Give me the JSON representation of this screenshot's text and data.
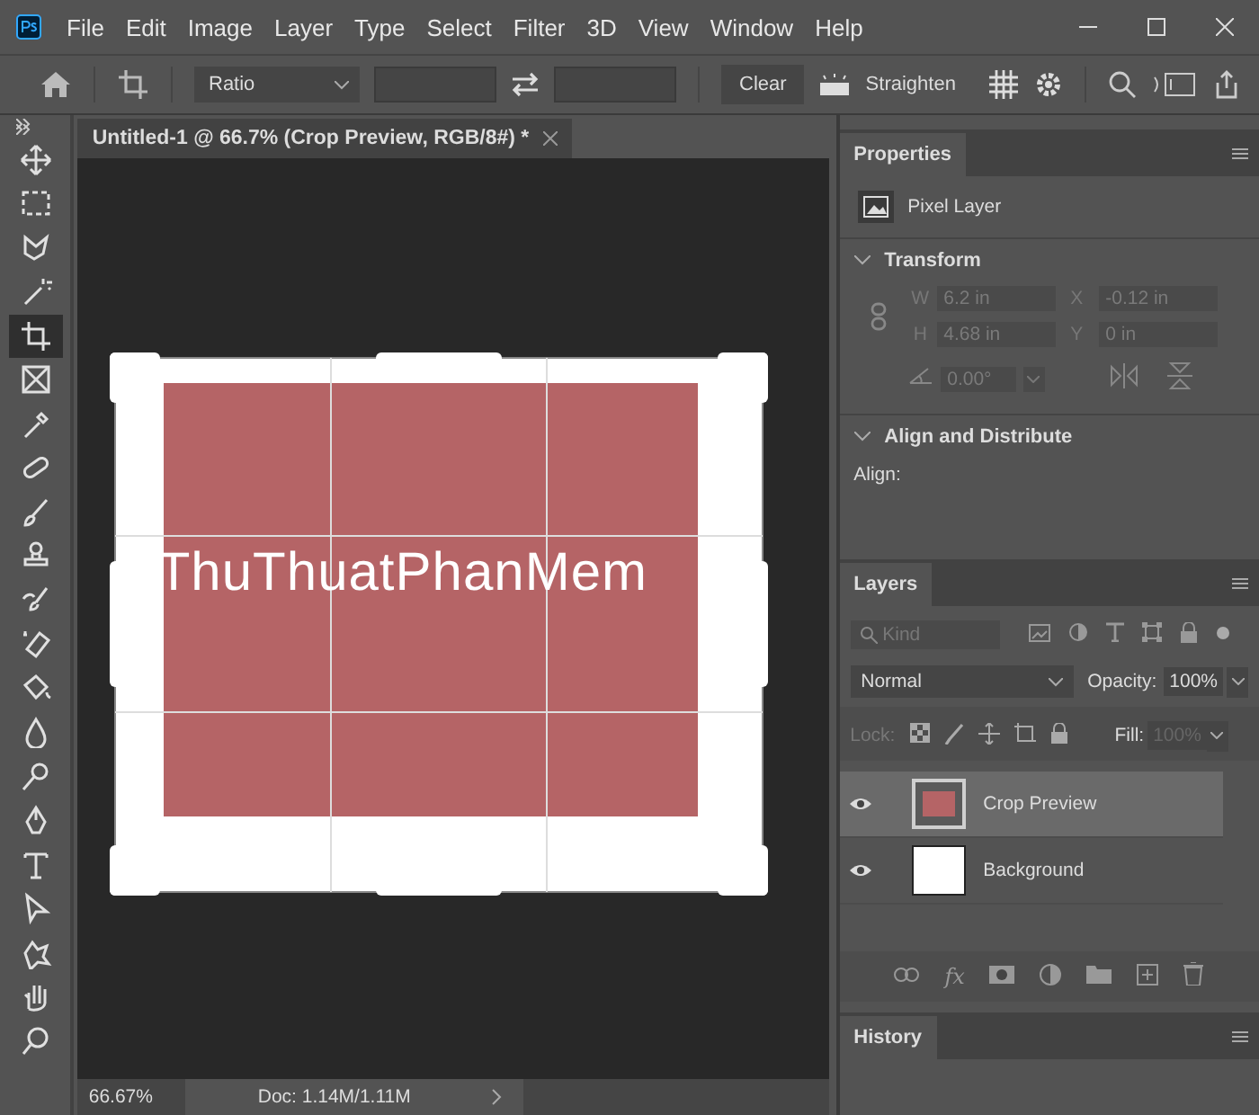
{
  "menu": [
    "File",
    "Edit",
    "Image",
    "Layer",
    "Type",
    "Select",
    "Filter",
    "3D",
    "View",
    "Window",
    "Help"
  ],
  "options_bar": {
    "ratio": "Ratio",
    "clear": "Clear",
    "straighten": "Straighten"
  },
  "document_tab": {
    "title": "Untitled-1 @ 66.7% (Crop Preview, RGB/8#) *"
  },
  "tools": [
    {
      "kind": "move",
      "selected": false
    },
    {
      "kind": "marquee",
      "selected": false
    },
    {
      "kind": "lasso",
      "selected": false
    },
    {
      "kind": "wand",
      "selected": false
    },
    {
      "kind": "crop",
      "selected": true
    },
    {
      "kind": "frame",
      "selected": false
    },
    {
      "kind": "eyedropper",
      "selected": false
    },
    {
      "kind": "healing",
      "selected": false
    },
    {
      "kind": "brush",
      "selected": false
    },
    {
      "kind": "stamp",
      "selected": false
    },
    {
      "kind": "history_brush",
      "selected": false
    },
    {
      "kind": "eraser",
      "selected": false
    },
    {
      "kind": "bucket",
      "selected": false
    },
    {
      "kind": "blur",
      "selected": false
    },
    {
      "kind": "dodge",
      "selected": false
    },
    {
      "kind": "pen",
      "selected": false
    },
    {
      "kind": "type",
      "selected": false
    },
    {
      "kind": "select",
      "selected": false
    },
    {
      "kind": "shape",
      "selected": false
    },
    {
      "kind": "hand",
      "selected": false
    },
    {
      "kind": "zoom",
      "selected": false
    }
  ],
  "canvas": {
    "text": "ThuThuatPhanMem"
  },
  "status_bar": {
    "zoom": "66.67%",
    "doc": "Doc: 1.14M/1.11M"
  },
  "properties": {
    "tab": "Properties",
    "layer_type": "Pixel Layer",
    "transform": {
      "title": "Transform",
      "expanded": true,
      "w_label": "W",
      "w": "6.2 in",
      "x_label": "X",
      "x": "-0.12 in",
      "h_label": "H",
      "h": "4.68 in",
      "y_label": "Y",
      "y": "0 in",
      "angle": "0.00°"
    },
    "align": {
      "title": "Align and Distribute",
      "expanded": true,
      "label": "Align:"
    }
  },
  "layers_panel": {
    "tab": "Layers",
    "filter_placeholder": "Kind",
    "blend_mode": "Normal",
    "opacity_label": "Opacity:",
    "opacity": "100%",
    "lock_label": "Lock:",
    "fill_label": "Fill:",
    "fill": "100%",
    "fx": "fx",
    "layers": [
      {
        "name": "Crop Preview",
        "visible": true,
        "selected": true
      },
      {
        "name": "Background",
        "visible": true,
        "selected": false
      }
    ]
  },
  "history_panel": {
    "tab": "History"
  }
}
